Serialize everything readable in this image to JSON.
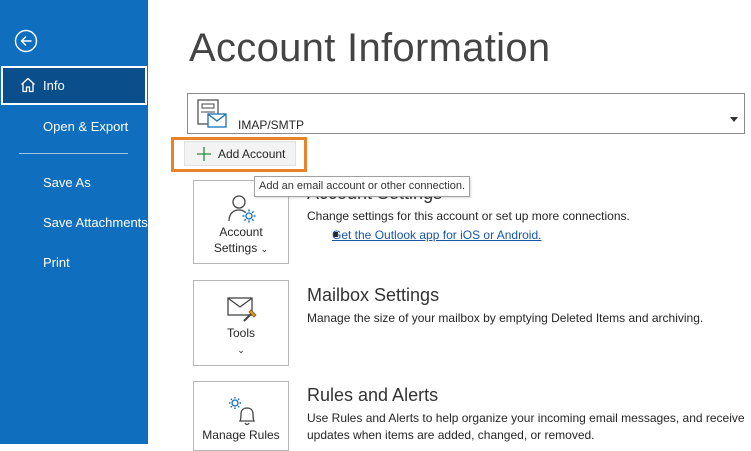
{
  "sidebar": {
    "back_icon": "back-arrow-icon",
    "items": [
      {
        "label": "Info",
        "icon": "home-icon",
        "selected": true
      },
      {
        "label": "Open & Export"
      },
      {
        "label": "Save As"
      },
      {
        "label": "Save Attachments"
      },
      {
        "label": "Print"
      }
    ]
  },
  "main": {
    "title": "Account Information",
    "account": {
      "label": "IMAP/SMTP",
      "icon": "mail-account-icon"
    },
    "add_account": {
      "label": "Add Account",
      "icon": "plus-icon"
    },
    "tooltip": "Add an email account or other connection.",
    "sections": [
      {
        "tile_line1": "Account",
        "tile_line2": "Settings",
        "tile_icon": "account-settings-icon",
        "title": "Account Settings",
        "desc": "Change settings for this account or set up more connections.",
        "link": "Get the Outlook app for iOS or Android."
      },
      {
        "tile_line1": "Tools",
        "tile_icon": "tools-mailbox-icon",
        "title": "Mailbox Settings",
        "desc": "Manage the size of your mailbox by emptying Deleted Items and archiving."
      },
      {
        "tile_line1": "Manage Rules",
        "tile_icon": "rules-bell-icon",
        "title": "Rules and Alerts",
        "desc_line1": "Use Rules and Alerts to help organize your incoming email messages, and receive",
        "desc_line2": "updates when items are added, changed, or removed."
      }
    ]
  },
  "colors": {
    "sidebar_bg": "#106ebe",
    "highlight": "#ea8227",
    "link": "#1a56a5"
  }
}
